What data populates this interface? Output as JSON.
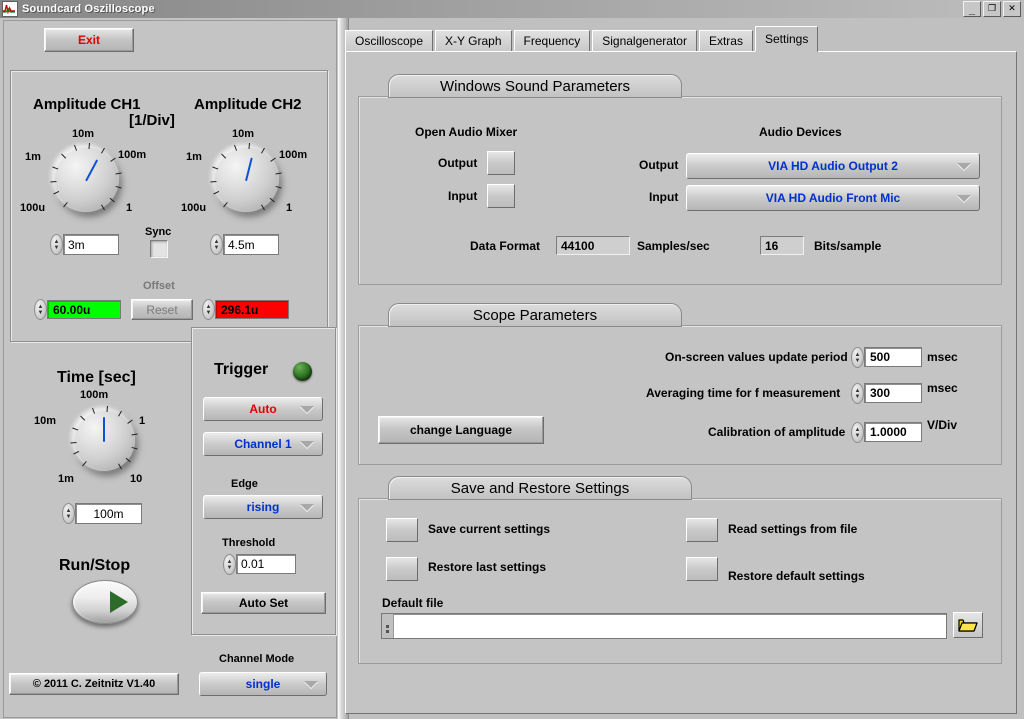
{
  "window": {
    "title": "Soundcard Oszilloscope",
    "icon": "waveform-icon",
    "minimize": "_",
    "maximize": "❐",
    "close": "✕"
  },
  "left": {
    "exit_label": "Exit",
    "copyright": "© 2011   C. Zeitnitz V1.40",
    "amplitude": {
      "ch1_title": "Amplitude CH1",
      "ch2_title": "Amplitude CH2",
      "unit": "[1/Div]",
      "scale_ticks": [
        "1m",
        "10m",
        "100m",
        "1",
        "100u"
      ],
      "ch1_value": "3m",
      "ch2_value": "4.5m",
      "sync_label": "Sync",
      "sync_checked": false,
      "offset_label": "Offset",
      "offset_ch1": "60.00u",
      "offset_ch2": "296.1u",
      "offset_ch1_color": "#00ff00",
      "offset_ch2_color": "#ff0000",
      "reset_label": "Reset"
    },
    "time": {
      "title": "Time [sec]",
      "ticks": [
        "10m",
        "100m",
        "1",
        "1m",
        "10"
      ],
      "value": "100m"
    },
    "runstop": {
      "label": "Run/Stop"
    },
    "trigger": {
      "title": "Trigger",
      "led_color": "#2d7a28",
      "mode": "Auto",
      "mode_color": "#e00000",
      "source": "Channel 1",
      "source_color": "#0030d0",
      "edge_label": "Edge",
      "edge": "rising",
      "threshold_label": "Threshold",
      "threshold": "0.01",
      "autoset_label": "Auto Set"
    },
    "channel_mode": {
      "label": "Channel Mode",
      "value": "single"
    }
  },
  "tabs": [
    {
      "label": "Oscilloscope",
      "active": false
    },
    {
      "label": "X-Y Graph",
      "active": false
    },
    {
      "label": "Frequency",
      "active": false
    },
    {
      "label": "Signalgenerator",
      "active": false
    },
    {
      "label": "Extras",
      "active": false
    },
    {
      "label": "Settings",
      "active": true
    }
  ],
  "settings": {
    "sound_params": {
      "caption": "Windows Sound Parameters",
      "mixer_title": "Open Audio Mixer",
      "mixer_output_label": "Output",
      "mixer_input_label": "Input",
      "devices_title": "Audio Devices",
      "dev_output_label": "Output",
      "dev_input_label": "Input",
      "dev_output_value": "VIA HD Audio Output 2",
      "dev_input_value": "VIA HD Audio Front Mic",
      "data_format_label": "Data Format",
      "sample_rate": "44100",
      "sample_rate_unit": "Samples/sec",
      "bit_depth": "16",
      "bit_depth_unit": "Bits/sample"
    },
    "scope_params": {
      "caption": "Scope Parameters",
      "update_period_label": "On-screen values update period",
      "update_period_value": "500",
      "update_period_unit": "msec",
      "averaging_label": "Averaging time for f measurement",
      "averaging_value": "300",
      "averaging_unit": "msec",
      "calibration_label": "Calibration of amplitude",
      "calibration_value": "1.0000",
      "calibration_unit": "V/Div",
      "language_button": "change Language"
    },
    "save_restore": {
      "caption": "Save and Restore Settings",
      "save_current": "Save current settings",
      "restore_last": "Restore last settings",
      "read_from_file": "Read settings from file",
      "restore_default": "Restore default settings",
      "default_file_label": "Default file",
      "default_file_value": "",
      "browse_icon": "folder-open-icon"
    }
  }
}
